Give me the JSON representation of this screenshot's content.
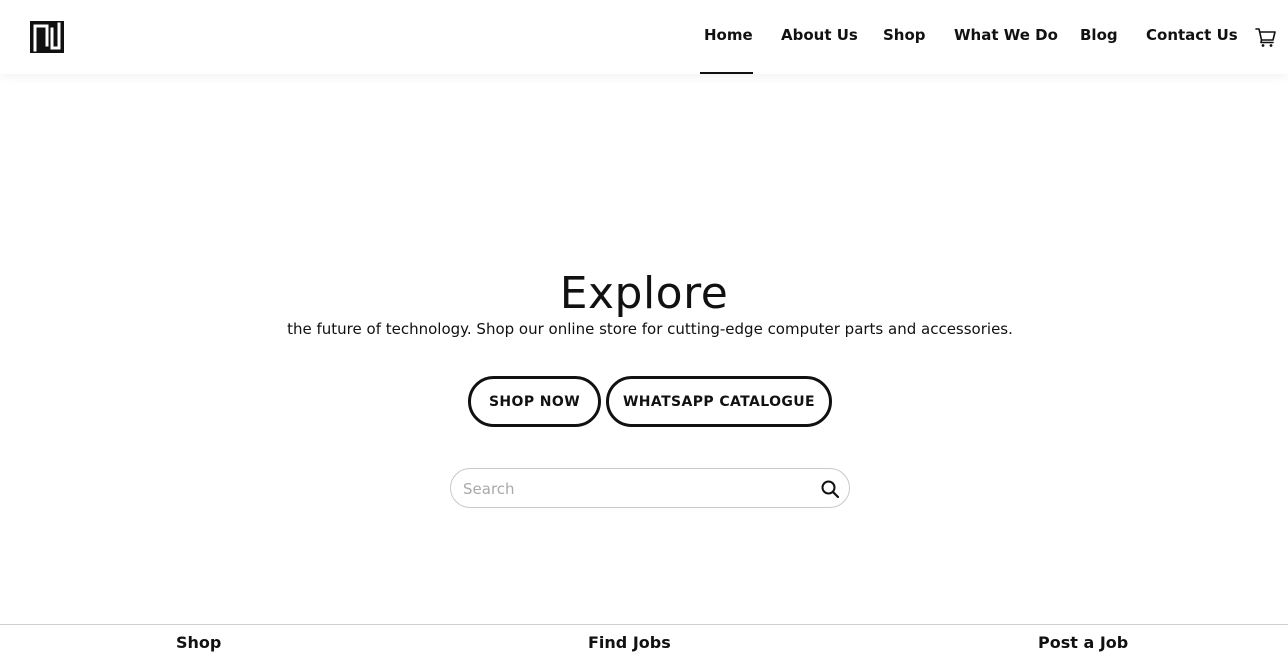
{
  "brand": {
    "logo_icon": "brand-logo-icon"
  },
  "nav": {
    "items": [
      {
        "label": "Home",
        "active": true
      },
      {
        "label": "About Us"
      },
      {
        "label": "Shop"
      },
      {
        "label": "What We Do"
      },
      {
        "label": "Blog"
      },
      {
        "label": "Contact Us"
      }
    ],
    "cart_icon": "cart-icon"
  },
  "hero": {
    "title": "Explore",
    "subtitle": "the future of technology. Shop our online store for cutting-edge computer parts and accessories.",
    "buttons": {
      "shop_now": "SHOP NOW",
      "whatsapp": "WHATSAPP CATALOGUE"
    }
  },
  "search": {
    "placeholder": "Search",
    "value": "",
    "icon": "search-icon"
  },
  "bottom_bar": {
    "items": [
      {
        "label": "Shop"
      },
      {
        "label": "Find Jobs"
      },
      {
        "label": "Post a Job"
      }
    ]
  },
  "colors": {
    "text": "#111111",
    "background": "#ffffff",
    "border": "#c9c9c9"
  }
}
